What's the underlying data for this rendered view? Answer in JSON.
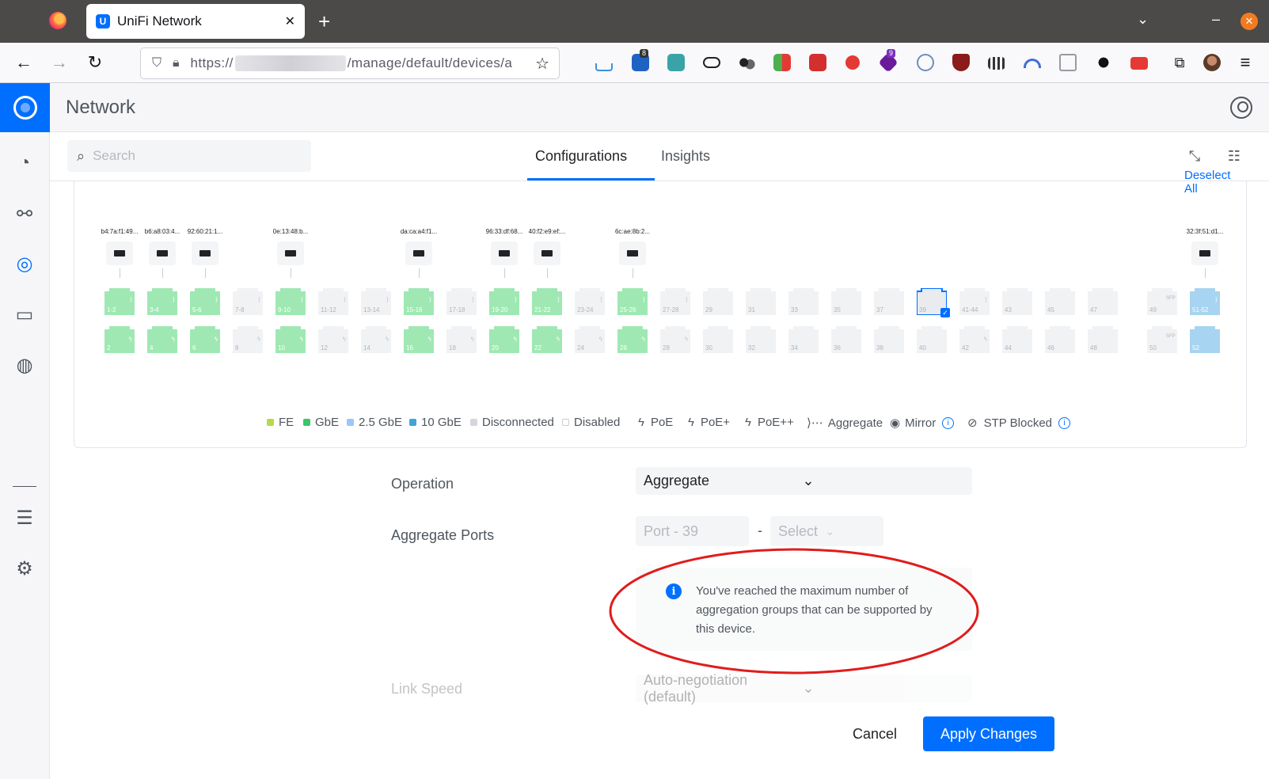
{
  "browser": {
    "tab_title": "UniFi Network",
    "tab_close": "✕",
    "new_tab": "+",
    "url_prefix": "https://",
    "url_suffix": "/manage/default/devices/a",
    "ext_badges": [
      "8",
      "9"
    ]
  },
  "app": {
    "title": "Network"
  },
  "subbar": {
    "search_placeholder": "Search",
    "tabs": [
      {
        "label": "Configurations",
        "active": true
      },
      {
        "label": "Insights",
        "active": false
      }
    ]
  },
  "panel": {
    "deselect_all": "Deselect All",
    "devices": [
      {
        "mac": "b4:7a:f1:49..."
      },
      {
        "mac": "b6:a8:03:4..."
      },
      {
        "mac": "92:60:21:1..."
      },
      {
        "mac": "0e:13:48:b..."
      },
      {
        "mac": "da:ca:a4:f1..."
      },
      {
        "mac": "96:33:df:68..."
      },
      {
        "mac": "40:f2:e9:ef:..."
      },
      {
        "mac": "6c:ae:8b:2..."
      },
      {
        "mac": "32:3f:51:d1..."
      }
    ],
    "top_ports": [
      "1-2",
      "3-4",
      "5-6",
      "7-8",
      "9-10",
      "11-12",
      "13-14",
      "15-16",
      "17-18",
      "19-20",
      "21-22",
      "23-24",
      "25-26",
      "27-28",
      "29",
      "31",
      "33",
      "35",
      "37",
      "39",
      "41-44",
      "43",
      "45",
      "47"
    ],
    "bottom_ports": [
      "2",
      "4",
      "6",
      "8",
      "10",
      "12",
      "14",
      "16",
      "18",
      "20",
      "22",
      "24",
      "26",
      "28",
      "30",
      "32",
      "34",
      "36",
      "38",
      "40",
      "42",
      "44",
      "46",
      "48"
    ],
    "sfp_top": [
      "49",
      "51-52"
    ],
    "sfp_bottom": [
      "50",
      "52"
    ],
    "sfp_tag": "SFP",
    "legend": {
      "fe": "FE",
      "gbe": "GbE",
      "gbe25": "2.5 GbE",
      "gbe10": "10 GbE",
      "disconnected": "Disconnected",
      "disabled": "Disabled",
      "poe": "PoE",
      "poe_plus": "PoE+",
      "poe_plusplus": "PoE++",
      "aggregate": "Aggregate",
      "mirror": "Mirror",
      "stp": "STP Blocked"
    },
    "colors": {
      "fe": "#b6d94c",
      "gbe": "#38c868",
      "gbe25": "#9ec5fb",
      "gbe10": "#3fa4d8",
      "connected_green": "#9fe8b3",
      "sfp_blue": "#a7d4f0",
      "disconnected": "#d3d6dc",
      "accent": "#006fff"
    }
  },
  "form": {
    "operation_label": "Operation",
    "operation_value": "Aggregate",
    "aggregate_label": "Aggregate Ports",
    "aggregate_start": "Port - 39",
    "aggregate_dash": "-",
    "aggregate_end_placeholder": "Select",
    "notice_text": "You've reached the maximum number of aggregation groups that can be supported by this device.",
    "link_speed_label": "Link Speed",
    "link_speed_value": "Auto-negotiation (default)",
    "cancel": "Cancel",
    "apply": "Apply Changes"
  }
}
